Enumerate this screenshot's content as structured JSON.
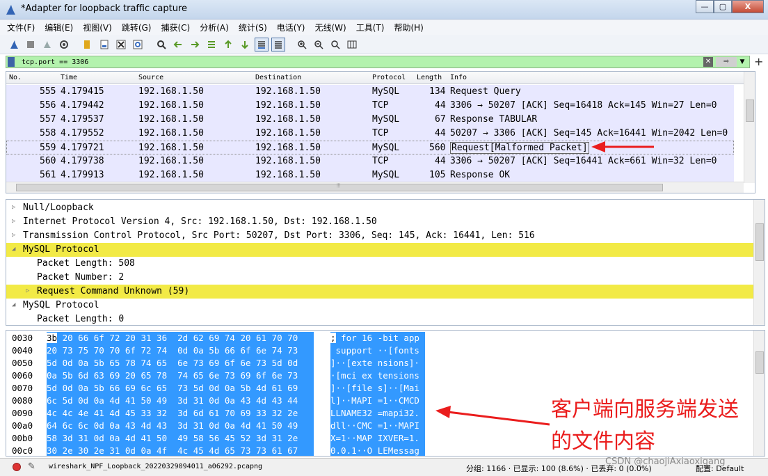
{
  "window": {
    "title": "*Adapter for loopback traffic capture",
    "controls": [
      "—",
      "▢",
      "X"
    ]
  },
  "menu": [
    "文件(F)",
    "编辑(E)",
    "视图(V)",
    "跳转(G)",
    "捕获(C)",
    "分析(A)",
    "统计(S)",
    "电话(Y)",
    "无线(W)",
    "工具(T)",
    "帮助(H)"
  ],
  "toolbar": {
    "icons": [
      "shark-fin-icon",
      "stop-icon",
      "restart-icon",
      "options-icon",
      "open-icon",
      "save-icon",
      "close-file-icon",
      "reload-icon",
      "find-icon",
      "back-icon",
      "forward-icon",
      "goto-icon",
      "first-icon",
      "last-icon",
      "autoscroll-icon",
      "colorize-icon",
      "zoom-in-icon",
      "zoom-out-icon",
      "zoom-reset-icon",
      "resize-columns-icon"
    ]
  },
  "filter": {
    "value": "tcp.port == 3306",
    "plus": "+"
  },
  "packet_list": {
    "columns": [
      "No.",
      "Time",
      "Source",
      "Destination",
      "Protocol",
      "Length",
      "Info"
    ],
    "rows": [
      {
        "no": "555",
        "time": "4.179415",
        "src": "192.168.1.50",
        "dst": "192.168.1.50",
        "proto": "MySQL",
        "len": "134",
        "info": "Request Query"
      },
      {
        "no": "556",
        "time": "4.179442",
        "src": "192.168.1.50",
        "dst": "192.168.1.50",
        "proto": "TCP",
        "len": "44",
        "info": "3306 → 50207 [ACK] Seq=16418 Ack=145 Win=27 Len=0"
      },
      {
        "no": "557",
        "time": "4.179537",
        "src": "192.168.1.50",
        "dst": "192.168.1.50",
        "proto": "MySQL",
        "len": "67",
        "info": "Response TABULAR"
      },
      {
        "no": "558",
        "time": "4.179552",
        "src": "192.168.1.50",
        "dst": "192.168.1.50",
        "proto": "TCP",
        "len": "44",
        "info": "50207 → 3306 [ACK] Seq=145 Ack=16441 Win=2042 Len=0"
      },
      {
        "no": "559",
        "time": "4.179721",
        "src": "192.168.1.50",
        "dst": "192.168.1.50",
        "proto": "MySQL",
        "len": "560",
        "info": "Request[Malformed Packet]"
      },
      {
        "no": "560",
        "time": "4.179738",
        "src": "192.168.1.50",
        "dst": "192.168.1.50",
        "proto": "TCP",
        "len": "44",
        "info": "3306 → 50207 [ACK] Seq=16441 Ack=661 Win=32 Len=0"
      },
      {
        "no": "561",
        "time": "4.179913",
        "src": "192.168.1.50",
        "dst": "192.168.1.50",
        "proto": "MySQL",
        "len": "105",
        "info": "Response OK"
      }
    ],
    "scroll_grip": "⦙⦙⦙"
  },
  "details": [
    {
      "expander": "▷",
      "indent": 0,
      "text": "Null/Loopback",
      "highlight": false
    },
    {
      "expander": "▷",
      "indent": 0,
      "text": "Internet Protocol Version 4, Src: 192.168.1.50, Dst: 192.168.1.50",
      "highlight": false
    },
    {
      "expander": "▷",
      "indent": 0,
      "text": "Transmission Control Protocol, Src Port: 50207, Dst Port: 3306, Seq: 145, Ack: 16441, Len: 516",
      "highlight": false
    },
    {
      "expander": "◢",
      "indent": 0,
      "text": "MySQL Protocol",
      "highlight": true
    },
    {
      "expander": "",
      "indent": 1,
      "text": "Packet Length: 508",
      "highlight": false
    },
    {
      "expander": "",
      "indent": 1,
      "text": "Packet Number: 2",
      "highlight": false
    },
    {
      "expander": "▷",
      "indent": 1,
      "text": "Request Command Unknown (59)",
      "highlight": true
    },
    {
      "expander": "◢",
      "indent": 0,
      "text": "MySQL Protocol",
      "highlight": false
    },
    {
      "expander": "",
      "indent": 1,
      "text": "Packet Length: 0",
      "highlight": false
    }
  ],
  "hex": [
    {
      "offset": "0030",
      "first": "3b",
      "bytes": " 20 66 6f 72 20 31 36  2d 62 69 74 20 61 70 70",
      "first_ascii": ";",
      "ascii": " for 16 -bit app"
    },
    {
      "offset": "0040",
      "first": "",
      "bytes": "20 73 75 70 70 6f 72 74  0d 0a 5b 66 6f 6e 74 73",
      "first_ascii": "",
      "ascii": " support ··[fonts"
    },
    {
      "offset": "0050",
      "first": "",
      "bytes": "5d 0d 0a 5b 65 78 74 65  6e 73 69 6f 6e 73 5d 0d",
      "first_ascii": "",
      "ascii": "]··[exte nsions]·"
    },
    {
      "offset": "0060",
      "first": "",
      "bytes": "0a 5b 6d 63 69 20 65 78  74 65 6e 73 69 6f 6e 73",
      "first_ascii": "",
      "ascii": "·[mci ex tensions"
    },
    {
      "offset": "0070",
      "first": "",
      "bytes": "5d 0d 0a 5b 66 69 6c 65  73 5d 0d 0a 5b 4d 61 69",
      "first_ascii": "",
      "ascii": "]··[file s]··[Mai"
    },
    {
      "offset": "0080",
      "first": "",
      "bytes": "6c 5d 0d 0a 4d 41 50 49  3d 31 0d 0a 43 4d 43 44",
      "first_ascii": "",
      "ascii": "l]··MAPI =1··CMCD"
    },
    {
      "offset": "0090",
      "first": "",
      "bytes": "4c 4c 4e 41 4d 45 33 32  3d 6d 61 70 69 33 32 2e",
      "first_ascii": "",
      "ascii": "LLNAME32 =mapi32."
    },
    {
      "offset": "00a0",
      "first": "",
      "bytes": "64 6c 6c 0d 0a 43 4d 43  3d 31 0d 0a 4d 41 50 49",
      "first_ascii": "",
      "ascii": "dll··CMC =1··MAPI"
    },
    {
      "offset": "00b0",
      "first": "",
      "bytes": "58 3d 31 0d 0a 4d 41 50  49 58 56 45 52 3d 31 2e",
      "first_ascii": "",
      "ascii": "X=1··MAP IXVER=1."
    },
    {
      "offset": "00c0",
      "first": "",
      "bytes": "30 2e 30 2e 31 0d 0a 4f  4c 45 4d 65 73 73 61 67",
      "first_ascii": "",
      "ascii": "0.0.1··O LEMessag"
    }
  ],
  "annotation": {
    "line1": "客户端向服务端发送",
    "line2": "的文件内容",
    "color": "#ea1d1d"
  },
  "status": {
    "file": "wireshark_NPF_Loopback_20220329094011_a06292.pcapng",
    "stats": "分组: 1166 · 已显示: 100 (8.6%) · 已丢弃: 0 (0.0%)",
    "profile": "配置: Default",
    "watermark": "CSDN @chaojiAxiaoxigang"
  }
}
